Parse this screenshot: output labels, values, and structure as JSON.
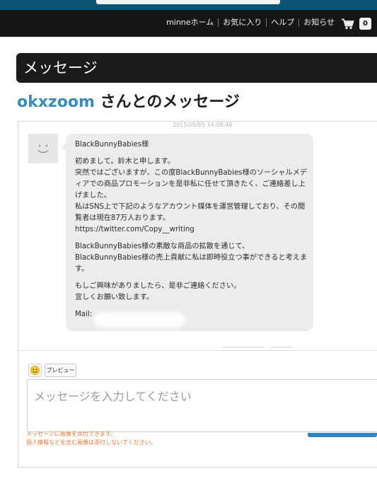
{
  "nav": {
    "items": [
      {
        "label": "minneホーム"
      },
      {
        "label": "お気に入り"
      },
      {
        "label": "ヘルプ"
      },
      {
        "label": "お知らせ"
      }
    ],
    "cart_count": "0"
  },
  "page": {
    "header": "メッセージ",
    "partner_name": "okxzoom",
    "subtitle_suffix": " さんとのメッセージ"
  },
  "thread": {
    "timestamp": "2015/05/05 14:08:46",
    "message": {
      "greeting": "BlackBunnyBabies様",
      "para1": [
        "初めまして。鈴木と申します。",
        "突然ではございますが、この度BlackBunnyBabies様のソーシャルメディアでの商品プロモーションを是非私に任せて頂きたく、ご連絡差し上げました。",
        "私はSNS上で下記のようなアカウント媒体を運営管理しており、その閲覧者は現在87万人おります。",
        "https://twitter.com/Copy__writing"
      ],
      "para2": [
        "BlackBunnyBabies様の素敵な商品の拡散を通じて、BlackBunnyBabies様の売上貢献に私は即時役立つ事ができると考えます。"
      ],
      "para3": [
        "もしご興味がありましたら、是非ご連絡ください。",
        "宜しくお願い致します。"
      ],
      "mail_label": "Mail:"
    }
  },
  "composer": {
    "preview_label": "プレビュー",
    "placeholder": "メッセージを入力してください",
    "note_attach": "メッセージに画像を添付できます。",
    "note_privacy": "個人情報などを含む画像は添付しないでください。"
  },
  "colors": {
    "navbar_bg": "#161616",
    "username": "#3b8db5",
    "accent_button": "#2f86bf",
    "note_text": "#e07a3a",
    "bubble_bg": "#ececec"
  },
  "icons": [
    "cart-icon",
    "avatar-face-icon",
    "emoji-icon"
  ]
}
